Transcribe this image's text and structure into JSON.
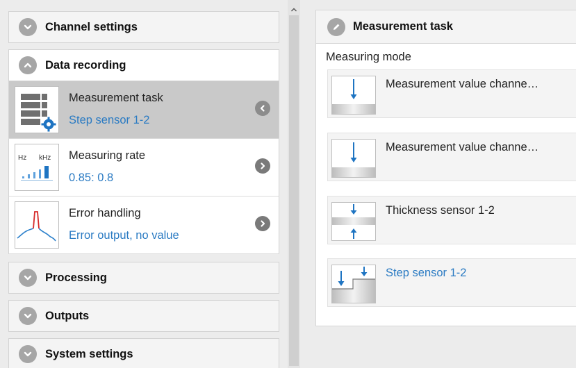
{
  "left_panel": {
    "sections": {
      "channel_settings": "Channel settings",
      "data_recording": "Data recording",
      "processing": "Processing",
      "outputs": "Outputs",
      "system_settings": "System settings"
    },
    "items": [
      {
        "title": "Measurement task",
        "value": "Step sensor 1-2",
        "icon": "measurement-task-icon",
        "selected": true
      },
      {
        "title": "Measuring rate",
        "value": "0.85: 0.8",
        "icon": "measuring-rate-icon",
        "thumb_hz": "Hz",
        "thumb_khz": "kHz",
        "selected": false
      },
      {
        "title": "Error handling",
        "value": "Error output, no value",
        "icon": "error-handling-icon",
        "selected": false
      }
    ]
  },
  "right_panel": {
    "title": "Measurement task",
    "mode_label": "Measuring mode",
    "options": [
      {
        "label": "Measurement value channe…",
        "icon": "single-channel-icon",
        "active": false
      },
      {
        "label": "Measurement value channe…",
        "icon": "single-channel-icon",
        "active": false
      },
      {
        "label": "Thickness sensor 1-2",
        "icon": "thickness-icon",
        "active": false
      },
      {
        "label": "Step sensor 1-2",
        "icon": "step-icon",
        "active": true
      }
    ]
  },
  "colors": {
    "accent_blue": "#2b7bc3",
    "selected_row": "#c9c9c9",
    "icon_gray": "#a6a6a6"
  }
}
